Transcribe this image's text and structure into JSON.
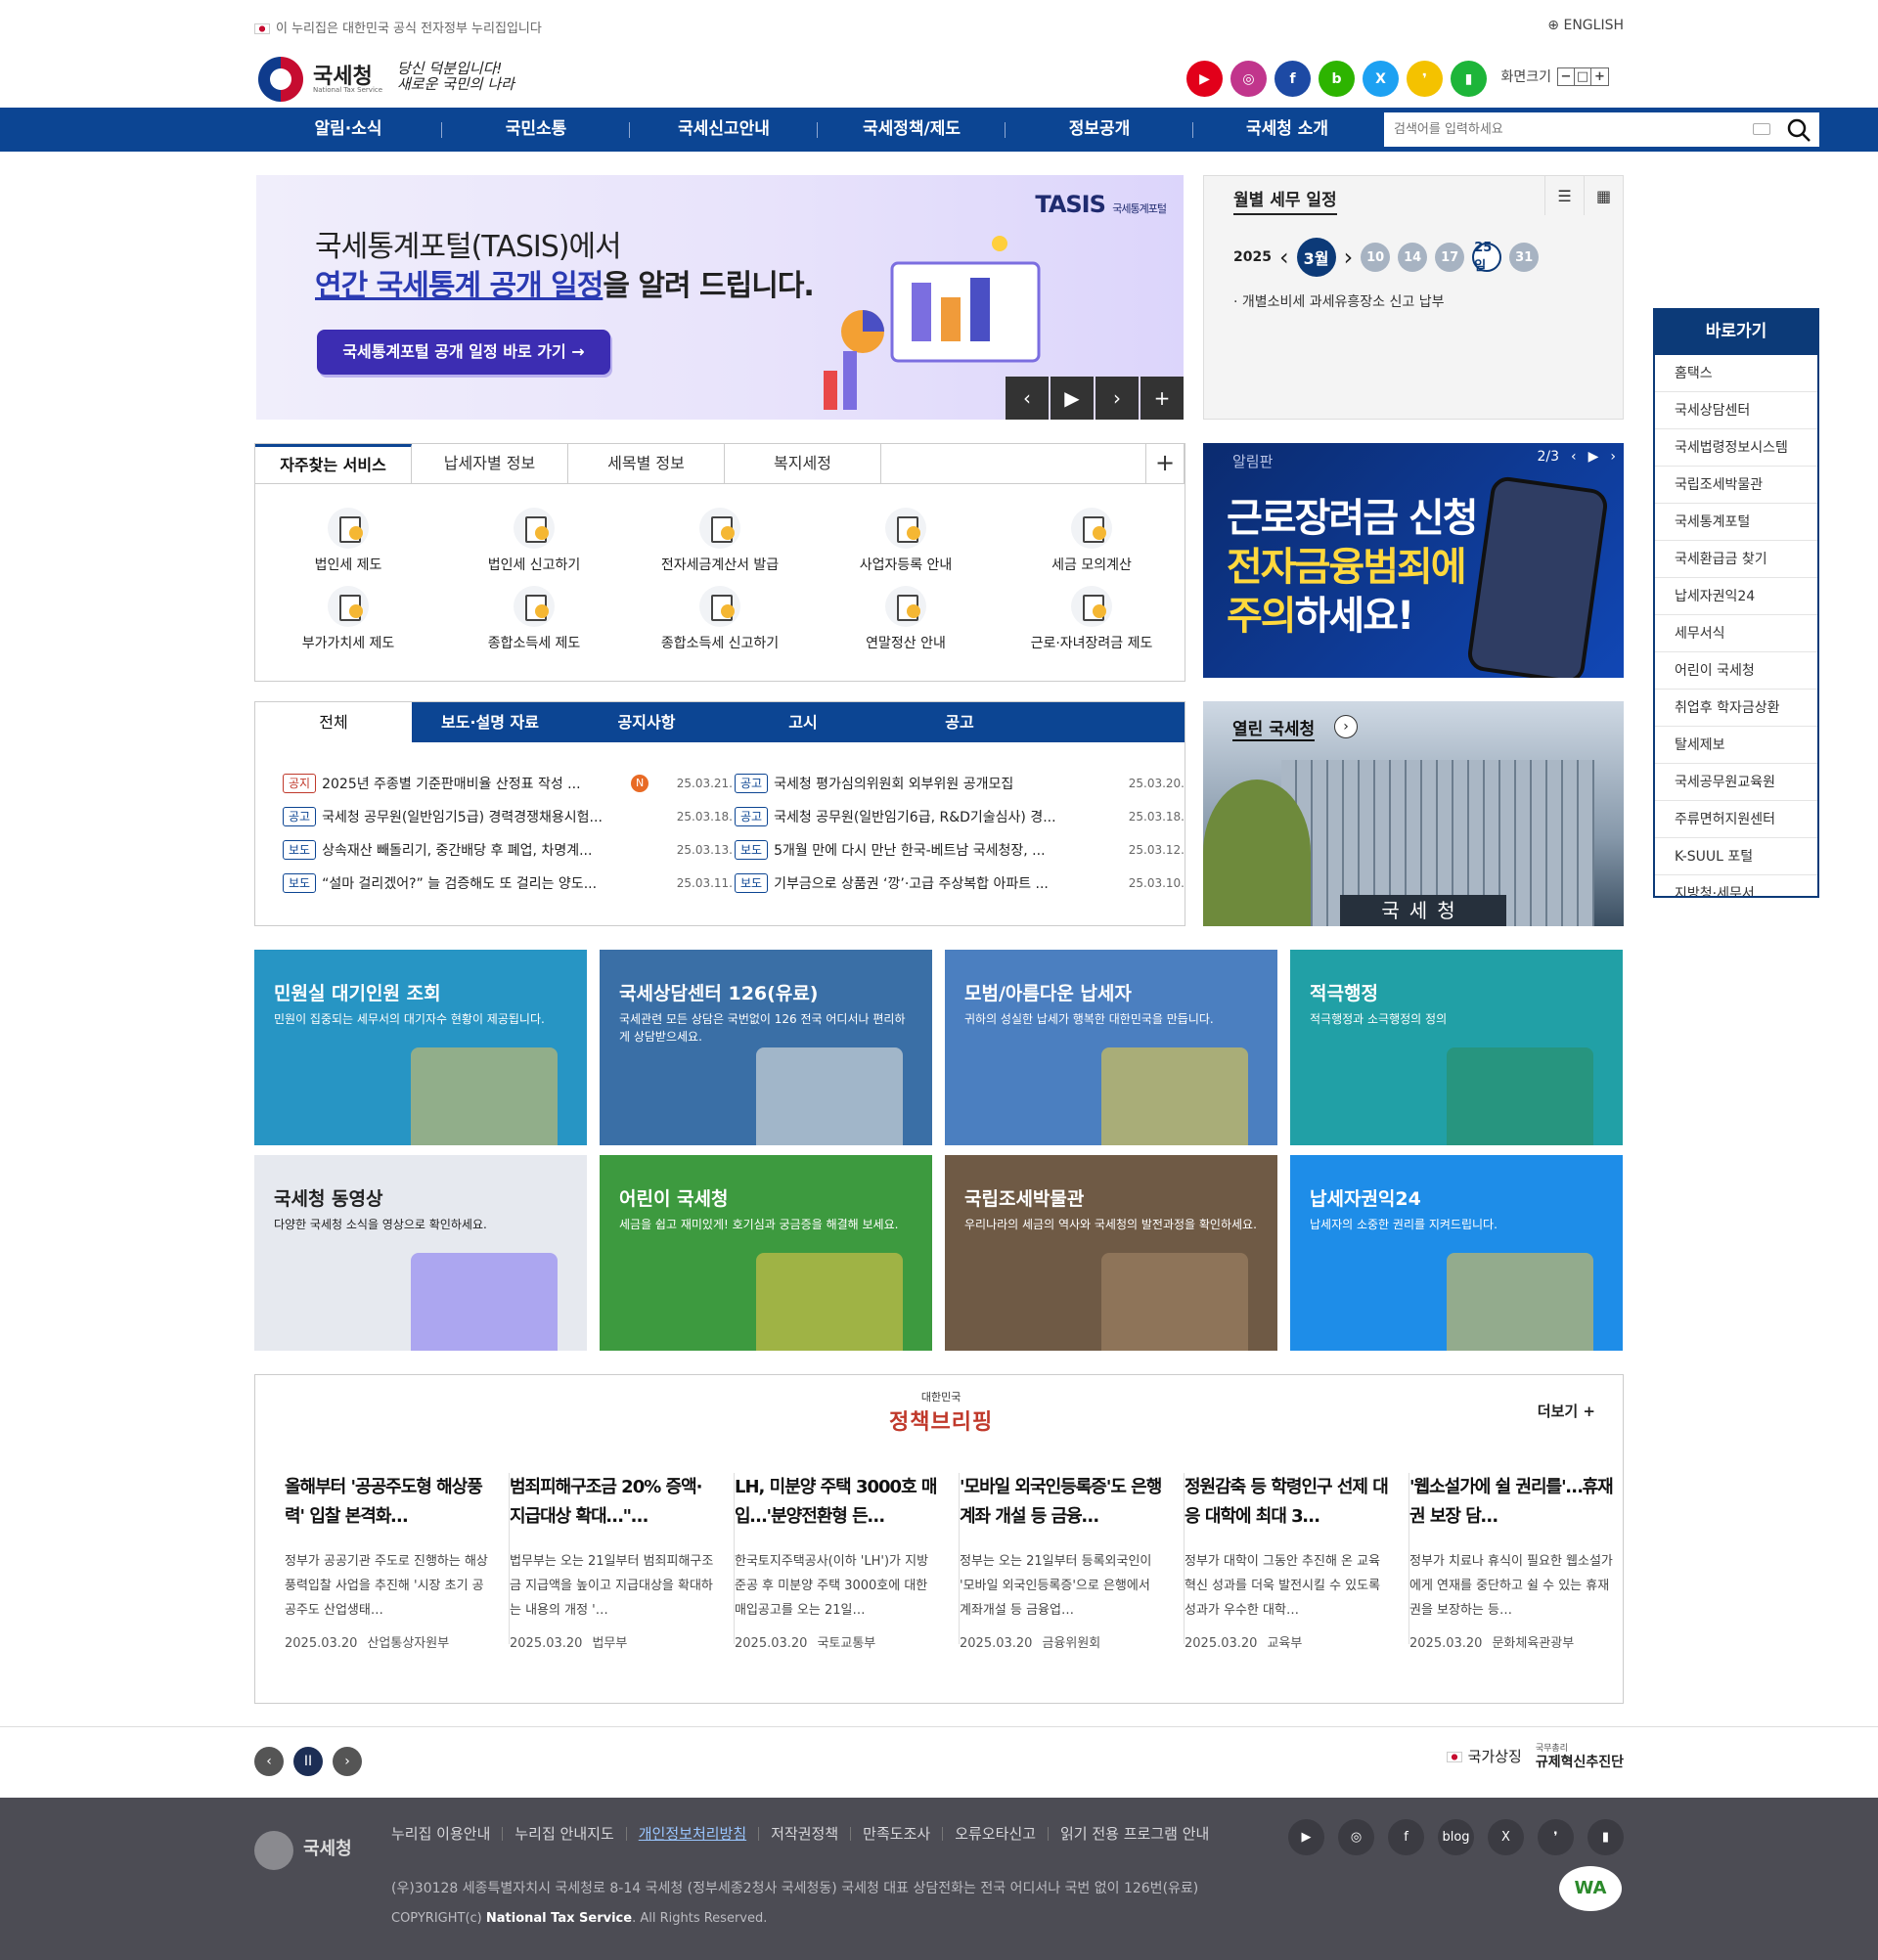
{
  "top": {
    "gov_notice": "이 누리집은 대한민국 공식 전자정부 누리집입니다",
    "english": "ENGLISH"
  },
  "header": {
    "logo_text": "국세청",
    "logo_sub": "National Tax Service",
    "slogan_line1": "당신 덕분입니다!",
    "slogan_line2": "새로운 국민의 나라",
    "sns": [
      {
        "icon": "youtube-icon",
        "color": "#e2001a",
        "glyph": "▶"
      },
      {
        "icon": "instagram-icon",
        "color": "#c1358c",
        "glyph": "◎"
      },
      {
        "icon": "facebook-icon",
        "color": "#1d4aa4",
        "glyph": "f"
      },
      {
        "icon": "blog-icon",
        "color": "#2db400",
        "glyph": "b"
      },
      {
        "icon": "x-icon",
        "color": "#1da1f2",
        "glyph": "X"
      },
      {
        "icon": "kakao-icon",
        "color": "#f4c200",
        "glyph": "❜"
      },
      {
        "icon": "post-icon",
        "color": "#1db539",
        "glyph": "▮"
      }
    ],
    "font_size_label": "화면크기",
    "font_btns": [
      "−",
      "□",
      "+"
    ]
  },
  "gnb": {
    "items": [
      "알림·소식",
      "국민소통",
      "국세신고안내",
      "국세정책/제도",
      "정보공개",
      "국세청 소개"
    ],
    "search_placeholder": "검색어를 입력하세요"
  },
  "banner": {
    "line1": "국세통계포털(TASIS)에서",
    "line2_em": "연간 국세통계 공개 일정",
    "line2_rest": "을 알려 드립니다.",
    "button": "국세통계포털 공개 일정 바로 가기 →",
    "brand": "TASIS",
    "brand_sub": "국세통계포털",
    "controls": [
      "‹",
      "▶",
      "›",
      "+"
    ]
  },
  "schedule": {
    "title": "월별 세무 일정",
    "year": "2025",
    "month": "3월",
    "days": [
      "10",
      "14",
      "17",
      "25일",
      "31"
    ],
    "item": "· 개별소비세 과세유흥장소 신고 납부"
  },
  "quick": {
    "title": "바로가기",
    "items": [
      "홈택스",
      "국세상담센터",
      "국세법령정보시스템",
      "국립조세박물관",
      "국세통계포털",
      "국세환급금 찾기",
      "납세자권익24",
      "세무서식",
      "어린이 국세청",
      "취업후 학자금상환",
      "탈세제보",
      "국세공무원교육원",
      "주류면허지원센터",
      "K-SUUL 포털",
      "지방청·세무서"
    ]
  },
  "services": {
    "tabs": [
      "자주찾는 서비스",
      "납세자별 정보",
      "세목별 정보",
      "복지세정"
    ],
    "items": [
      "법인세 제도",
      "법인세 신고하기",
      "전자세금계산서 발급",
      "사업자등록 안내",
      "세금 모의계산",
      "부가가치세 제도",
      "종합소득세 제도",
      "종합소득세 신고하기",
      "연말정산 안내",
      "근로·자녀장려금 제도"
    ]
  },
  "notice_card": {
    "label": "알림판",
    "page": "2/3",
    "line1": "근로장려금 신청",
    "line2": "전자금융범죄에",
    "line3a": "주의",
    "line3b": "하세요!"
  },
  "news": {
    "tabs": [
      "전체",
      "보도·설명 자료",
      "공지사항",
      "고시",
      "공고"
    ],
    "left": [
      {
        "badge": "공지",
        "title": "2025년 주종별 기준판매비율 산정표 작성 ...",
        "date": "25.03.21.",
        "new": "N"
      },
      {
        "badge": "공고",
        "title": "국세청 공무원(일반임기5급) 경력경쟁채용시험...",
        "date": "25.03.18."
      },
      {
        "badge": "보도",
        "title": "상속재산 빼돌리기, 중간배당 후 폐업, 차명계...",
        "date": "25.03.13."
      },
      {
        "badge": "보도",
        "title": "“설마 걸리겠어?” 늘 검증해도 또 걸리는 양도...",
        "date": "25.03.11."
      }
    ],
    "right": [
      {
        "badge": "공고",
        "title": "국세청 평가심의위원회 외부위원 공개모집",
        "date": "25.03.20."
      },
      {
        "badge": "공고",
        "title": "국세청 공무원(일반임기6급, R&D기술심사) 경...",
        "date": "25.03.18."
      },
      {
        "badge": "보도",
        "title": "5개월 만에 다시 만난 한국-베트남 국세청장, ...",
        "date": "25.03.12."
      },
      {
        "badge": "보도",
        "title": "기부금으로 상품권 ‘깡’·고급 주상복합 아파트 ...",
        "date": "25.03.10."
      }
    ]
  },
  "open_nts": {
    "title": "열린 국세청",
    "sign": "국세청"
  },
  "tiles": [
    {
      "title": "민원실 대기인원 조회",
      "desc": "민원이 집중되는 세무서의 대기자수 현황이 제공됩니다.",
      "bg": "#2795c4"
    },
    {
      "title": "국세상담센터 126(유료)",
      "desc": "국세관련 모든 상담은 국번없이 126 전국 어디서나 편리하게 상담받으세요.",
      "bg": "#3a6fa6"
    },
    {
      "title": "모범/아름다운 납세자",
      "desc": "귀하의 성실한 납세가 행복한 대한민국을 만듭니다.",
      "bg": "#4b7fc0"
    },
    {
      "title": "적극행정",
      "desc": "적극행정과 소극행정의 정의",
      "bg": "#21a0a6"
    },
    {
      "title": "국세청 동영상",
      "desc": "다양한 국세청 소식을 영상으로 확인하세요.",
      "bg": "#e6e9ef"
    },
    {
      "title": "어린이 국세청",
      "desc": "세금을 쉽고 재미있게! 호기심과 궁금증을 해결해 보세요.",
      "bg": "#3d9a3f"
    },
    {
      "title": "국립조세박물관",
      "desc": "우리나라의 세금의 역사와 국세청의 발전과정을 확인하세요.",
      "bg": "#6f5a45"
    },
    {
      "title": "납세자권익24",
      "desc": "납세자의 소중한 권리를 지켜드립니다.",
      "bg": "#1e8de8"
    }
  ],
  "policy": {
    "logo_small": "대한민국",
    "logo": "정책브리핑",
    "more": "더보기 +",
    "items": [
      {
        "title": "올해부터 '공공주도형 해상풍력' 입찰 본격화…",
        "desc": "정부가 공공기관 주도로 진행하는 해상풍력입찰 사업을 추진해 '시장 초기 공공주도 산업생태…",
        "date": "2025.03.20",
        "org": "산업통상자원부"
      },
      {
        "title": "범죄피해구조금 20% 증액·지급대상 확대…\"…",
        "desc": "법무부는 오는 21일부터 범죄피해구조금 지급액을 높이고 지급대상을 확대하는 내용의 개정 '…",
        "date": "2025.03.20",
        "org": "법무부"
      },
      {
        "title": "LH, 미분양 주택 3000호 매입…'분양전환형 든…",
        "desc": "한국토지주택공사(이하 'LH')가 지방 준공 후 미분양 주택 3000호에 대한 매입공고를 오는 21일…",
        "date": "2025.03.20",
        "org": "국토교통부"
      },
      {
        "title": "'모바일 외국인등록증'도 은행계좌 개설 등 금융…",
        "desc": "정부는 오는 21일부터 등록외국인이 '모바일 외국인등록증'으로 은행에서 계좌개설 등 금융업…",
        "date": "2025.03.20",
        "org": "금융위원회"
      },
      {
        "title": "정원감축 등 학령인구 선제 대응 대학에 최대 3…",
        "desc": "정부가 대학이 그동안 추진해 온 교육혁신 성과를 더욱 발전시킬 수 있도록 성과가 우수한 대학…",
        "date": "2025.03.20",
        "org": "교육부"
      },
      {
        "title": "'웹소설가에 쉴 권리를'…휴재권 보장 담…",
        "desc": "정부가 치료나 휴식이 필요한 웹소설가에게 연재를 중단하고 쉴 수 있는 휴재권을 보장하는 등…",
        "date": "2025.03.20",
        "org": "문화체육관광부"
      }
    ]
  },
  "bottom": {
    "controls": [
      "‹",
      "II",
      "›"
    ],
    "symbol": "국가상징",
    "reform_small": "국무총리",
    "reform": "규제혁신추진단"
  },
  "footer": {
    "logo": "국세청",
    "links": [
      "누리집 이용안내",
      "누리집 안내지도",
      "개인정보처리방침",
      "저작권정책",
      "만족도조사",
      "오류오타신고",
      "읽기 전용 프로그램 안내"
    ],
    "address": "(우)30128 세종특별자치시 국세청로 8-14 국세청 (정부세종2청사 국세청동) 국세청 대표 상담전화는 전국 어디서나 국번 없이 126번(유료)",
    "copy_pre": "COPYRIGHT(c) ",
    "copy_name": "National Tax Service",
    "copy_post": ". All Rights Reserved.",
    "sns": [
      "▶",
      "◎",
      "f",
      "blog",
      "X",
      "❜",
      "▮"
    ],
    "wa": "WA"
  }
}
